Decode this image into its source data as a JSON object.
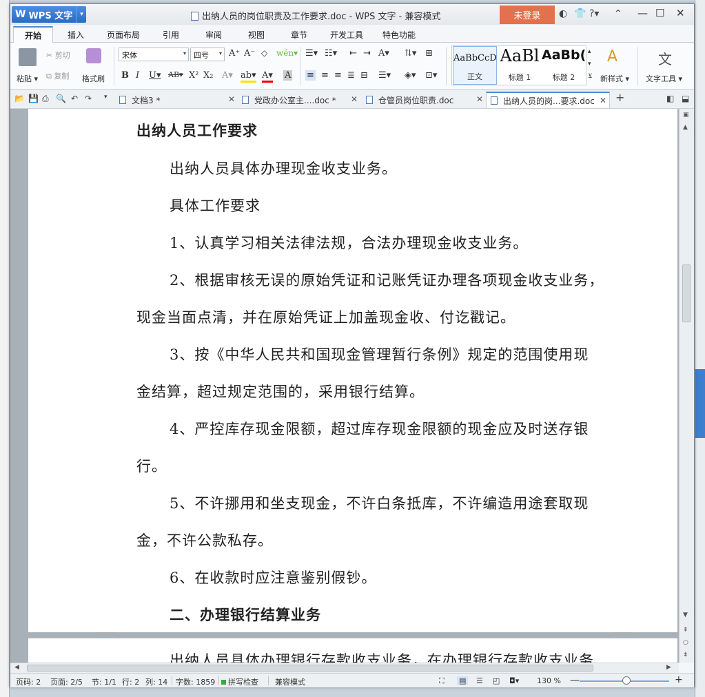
{
  "window": {
    "app_name": "WPS 文字",
    "title": "出纳人员的岗位职责及工作要求.doc - WPS 文字 - 兼容模式",
    "login_label": "未登录"
  },
  "ribbon_tabs": [
    "开始",
    "插入",
    "页面布局",
    "引用",
    "审阅",
    "视图",
    "章节",
    "开发工具",
    "特色功能"
  ],
  "ribbon": {
    "paste": "粘贴",
    "cut": "剪切",
    "copy": "复制",
    "format_painter": "格式刷",
    "font_name": "宋体",
    "font_size": "四号",
    "styles": [
      {
        "preview": "AaBbCcD",
        "label": "正文"
      },
      {
        "preview": "AaBl",
        "label": "标题 1"
      },
      {
        "preview": "AaBb(",
        "label": "标题 2"
      }
    ],
    "new_style": "新样式",
    "text_tools": "文字工具"
  },
  "doc_tabs": [
    {
      "label": "文档3 *",
      "active": false
    },
    {
      "label": "党政办公室主....doc *",
      "active": false
    },
    {
      "label": "仓管员岗位职责.doc",
      "active": false
    },
    {
      "label": "出纳人员的岗...要求.doc",
      "active": true
    }
  ],
  "document": {
    "lines": [
      {
        "text": "出纳人员工作要求",
        "bold": true,
        "indent": false
      },
      {
        "text": "出纳人员具体办理现金收支业务。",
        "bold": false,
        "indent": true
      },
      {
        "text": "具体工作要求",
        "bold": false,
        "indent": true
      },
      {
        "text": "1、认真学习相关法律法规，合法办理现金收支业务。",
        "bold": false,
        "indent": true
      },
      {
        "text": "2、根据审核无误的原始凭证和记账凭证办理各项现金收支业务，",
        "bold": false,
        "indent": true
      },
      {
        "text": "现金当面点清，并在原始凭证上加盖现金收、付讫戳记。",
        "bold": false,
        "indent": false
      },
      {
        "text": "3、按《中华人民共和国现金管理暂行条例》规定的范围使用现",
        "bold": false,
        "indent": true
      },
      {
        "text": "金结算，超过规定范围的，采用银行结算。",
        "bold": false,
        "indent": false
      },
      {
        "text": "4、严控库存现金限额，超过库存现金限额的现金应及时送存银",
        "bold": false,
        "indent": true
      },
      {
        "text": "行。",
        "bold": false,
        "indent": false
      },
      {
        "text": "5、不许挪用和坐支现金，不许白条抵库，不许编造用途套取现",
        "bold": false,
        "indent": true
      },
      {
        "text": "金，不许公款私存。",
        "bold": false,
        "indent": false
      },
      {
        "text": "6、在收款时应注意鉴别假钞。",
        "bold": false,
        "indent": true
      },
      {
        "text": "二、办理银行结算业务",
        "bold": true,
        "indent": true
      }
    ],
    "next_page_line": "出纳人员具体办理银行存款收支业务，在办理银行存款收支业务"
  },
  "status": {
    "page_num": "页码: 2",
    "pages": "页面: 2/5",
    "section": "节: 1/1",
    "row": "行: 2",
    "col": "列: 14",
    "word_count": "字数: 1859",
    "spell_check": "拼写检查",
    "compat_mode": "兼容模式",
    "zoom": "130 %"
  }
}
